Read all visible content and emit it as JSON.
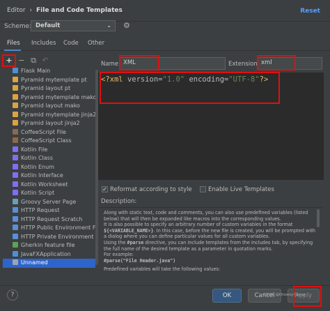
{
  "header": {
    "crumb_parent": "Editor",
    "crumb_sep": "›",
    "crumb_current": "File and Code Templates",
    "reset": "Reset"
  },
  "scheme": {
    "label": "Scheme:",
    "value": "Default"
  },
  "tabs": [
    {
      "label": "Files"
    },
    {
      "label": "Includes"
    },
    {
      "label": "Code"
    },
    {
      "label": "Other"
    }
  ],
  "toolbar": {
    "add": "+",
    "remove": "−",
    "copy": "⧉",
    "reset": "↶"
  },
  "templates": [
    {
      "label": "Flask Main",
      "color": "#4c8fd6"
    },
    {
      "label": "Pyramid mytemplate pt",
      "color": "#d9a441"
    },
    {
      "label": "Pyramid layout pt",
      "color": "#d9a441"
    },
    {
      "label": "Pyramid mytemplate mako",
      "color": "#d9a441"
    },
    {
      "label": "Pyramid layout mako",
      "color": "#d9a441"
    },
    {
      "label": "Pyramid mytemplate jinja2",
      "color": "#d9a441"
    },
    {
      "label": "Pyramid layout jinja2",
      "color": "#d9a441"
    },
    {
      "label": "CoffeeScript File",
      "color": "#8a6a4a"
    },
    {
      "label": "CoffeeScript Class",
      "color": "#8a6a4a"
    },
    {
      "label": "Kotlin File",
      "color": "#7f6ff0"
    },
    {
      "label": "Kotlin Class",
      "color": "#7f6ff0"
    },
    {
      "label": "Kotlin Enum",
      "color": "#7f6ff0"
    },
    {
      "label": "Kotlin Interface",
      "color": "#7f6ff0"
    },
    {
      "label": "Kotlin Worksheet",
      "color": "#7f6ff0"
    },
    {
      "label": "Kotlin Script",
      "color": "#7f6ff0"
    },
    {
      "label": "Groovy Server Page",
      "color": "#6a9fb5"
    },
    {
      "label": "HTTP Request",
      "color": "#5b8fd6"
    },
    {
      "label": "HTTP Request Scratch",
      "color": "#5b8fd6"
    },
    {
      "label": "HTTP Public Environment File",
      "color": "#5b8fd6"
    },
    {
      "label": "HTTP Private Environment File",
      "color": "#5b8fd6"
    },
    {
      "label": "Gherkin feature file",
      "color": "#5aa454"
    },
    {
      "label": "JavaFXApplication",
      "color": "#4c8fd6"
    },
    {
      "label": "Unnamed",
      "color": "#9aa7b0"
    }
  ],
  "selected_index": 22,
  "name": {
    "label": "Name:",
    "value": "XML"
  },
  "extension": {
    "label": "Extension:",
    "value": "xml"
  },
  "code": {
    "open": "<?xml ",
    "attr1": "version=",
    "val1": "\"1.0\"",
    "space": " ",
    "attr2": "encoding=",
    "val2": "\"UTF-8\"",
    "close": "?>"
  },
  "options": {
    "reformat": "Reformat according to style",
    "live": "Enable Live Templates",
    "reformat_checked": true,
    "live_checked": false
  },
  "description": {
    "label": "Description:",
    "p1": "Along with static text, code and comments, you can also use predefined variables (listed below) that will then be expanded like macros into the corresponding values.",
    "p2a": "It is also possible to specify an arbitrary number of custom variables in the format ",
    "p2b": "${<VARIABLE_NAME>}",
    "p2c": ". In this case, before the new file is created, you will be prompted with a dialog where you can define particular values for all custom variables.",
    "p3a": "Using the ",
    "p3b": "#parse",
    "p3c": " directive, you can include templates from the Includes tab, by specifying the full name of the desired template as a parameter in quotation marks.",
    "p4a": "For example:",
    "p4b": "#parse(\"File Header.java\")",
    "p5": "Predefined variables will take the following values:"
  },
  "footer": {
    "help": "?",
    "ok": "OK",
    "cancel": "Cancel",
    "apply": "Apply",
    "watermark": "CSDN @Drowsy小Java"
  }
}
